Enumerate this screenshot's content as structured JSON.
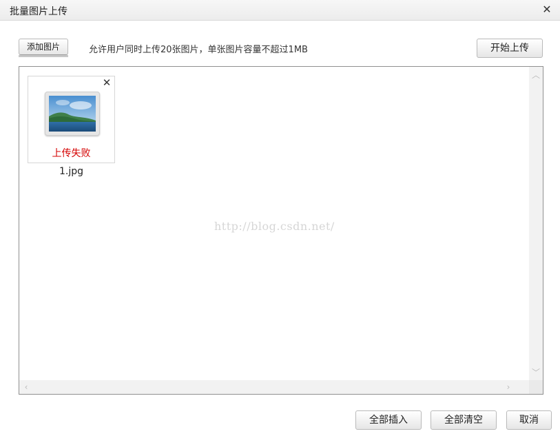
{
  "dialog": {
    "title": "批量图片上传",
    "close_icon": "close-icon"
  },
  "toolbar": {
    "add_label": "添加图片",
    "hint": "允许用户同时上传20张图片，单张图片容量不超过1MB",
    "start_label": "开始上传"
  },
  "files": [
    {
      "name": "1.jpg",
      "status": "上传失败",
      "status_color": "#d40000",
      "remove_icon": "close-icon"
    }
  ],
  "watermark": "http://blog.csdn.net/",
  "footer": {
    "insert_all_label": "全部插入",
    "clear_all_label": "全部清空",
    "cancel_label": "取消"
  },
  "scroll": {
    "up_icon": "chevron-up-icon",
    "down_icon": "chevron-down-icon",
    "left_icon": "chevron-left-icon",
    "right_icon": "chevron-right-icon"
  }
}
